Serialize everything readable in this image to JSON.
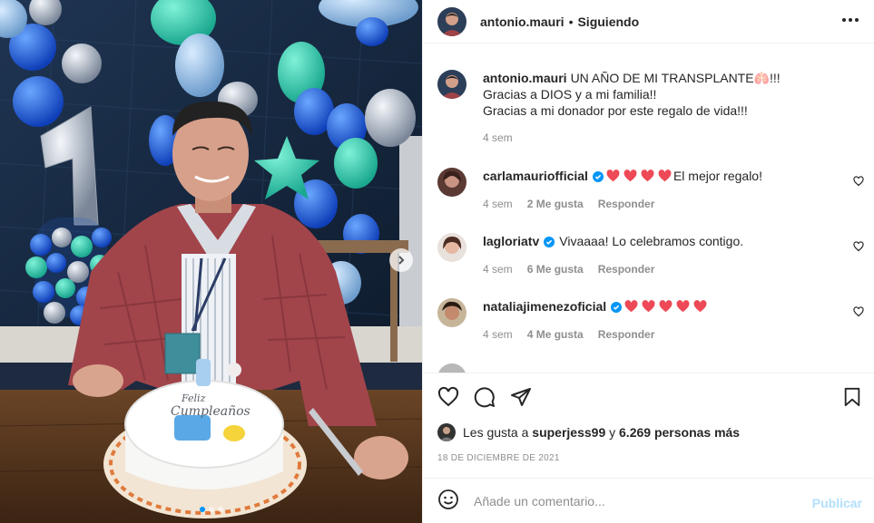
{
  "post": {
    "author": "antonio.mauri",
    "follow_status": "Siguiendo",
    "separator": "•",
    "caption_lines": [
      "UN AÑO DE MI TRANSPLANTE🫁!!!",
      "Gracias a DIOS y a mi familia!!",
      "Gracias a mi donador por este regalo de vida!!!"
    ],
    "caption_time": "4 sem",
    "cake_text": [
      "Feliz",
      "Cumpleaños"
    ],
    "carousel": {
      "total_slides": 3,
      "active_slide": 1
    }
  },
  "comments": [
    {
      "user": "carlamauriofficial",
      "verified": true,
      "hearts": 4,
      "text": "El mejor regalo!",
      "time": "4 sem",
      "likes": "2 Me gusta",
      "reply": "Responder"
    },
    {
      "user": "lagloriatv",
      "verified": true,
      "hearts": 0,
      "text": "Vivaaaa! Lo celebramos contigo.",
      "time": "4 sem",
      "likes": "6 Me gusta",
      "reply": "Responder"
    },
    {
      "user": "nataliajimenezoficial",
      "verified": true,
      "hearts": 5,
      "text": "",
      "time": "4 sem",
      "likes": "4 Me gusta",
      "reply": "Responder"
    }
  ],
  "likes": {
    "prefix": "Les gusta a",
    "user": "superjess99",
    "conj": "y",
    "others": "6.269 personas más"
  },
  "date": "18 DE DICIEMBRE DE 2021",
  "comment_box": {
    "placeholder": "Añade un comentario...",
    "publish": "Publicar"
  },
  "icons": [
    "heart-icon",
    "comment-icon",
    "share-icon",
    "bookmark-icon",
    "emoji-icon",
    "more-icon",
    "next-arrow-icon",
    "verified-badge-icon"
  ],
  "colors": {
    "accent": "#0095f6",
    "heart": "#ed4956",
    "publish_disabled": "#b2dffc",
    "muted": "#8e8e8e",
    "text": "#262626"
  }
}
